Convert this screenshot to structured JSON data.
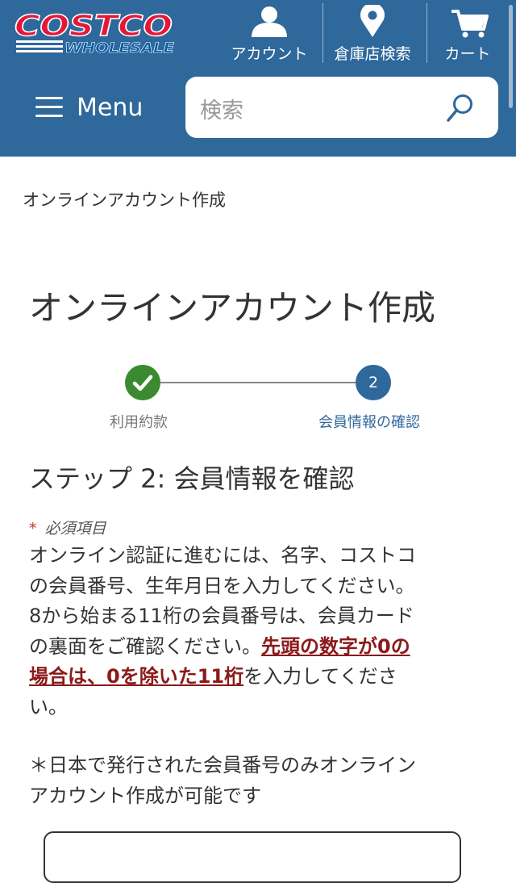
{
  "header": {
    "logo": {
      "line1": "COSTCO",
      "line2": "WHOLESALE",
      "brand_red": "#e31837",
      "brand_blue": "#005daa"
    },
    "nav": [
      {
        "label": "アカウント",
        "icon": "person-icon"
      },
      {
        "label": "倉庫店検索",
        "icon": "location-pin-icon"
      },
      {
        "label": "カート",
        "icon": "cart-icon"
      }
    ],
    "menu_label": "Menu",
    "search": {
      "placeholder": "検索",
      "icon": "search-icon"
    },
    "background": "#2f689b"
  },
  "breadcrumb": "オンラインアカウント作成",
  "page_title": "オンラインアカウント作成",
  "stepper": {
    "steps": [
      {
        "label": "利用約款",
        "state": "complete",
        "icon": "checkmark-icon",
        "color": "#3a8b30"
      },
      {
        "label": "会員情報の確認",
        "number": "2",
        "state": "current",
        "color": "#2f689b"
      }
    ]
  },
  "step_heading": "ステップ 2: 会員情報を確認",
  "required_note": {
    "marker": "*",
    "text": "必須項目"
  },
  "instructions": {
    "line1": "オンライン認証に進むには、名字、コストコ",
    "line2": "の会員番号、生年月日を入力してください。",
    "line3": "8から始まる11桁の会員番号は、会員カード",
    "line4_plain": "の裏面をご確認ください。",
    "line4_highlight": "先頭の数字が0の",
    "line5_highlight": "場合は、0を除いた11桁",
    "line5_plain": "を入力してくださ",
    "line6": "い。"
  },
  "note": {
    "line1": "＊日本で発行された会員番号のみオンライン",
    "line2": "アカウント作成が可能です"
  }
}
